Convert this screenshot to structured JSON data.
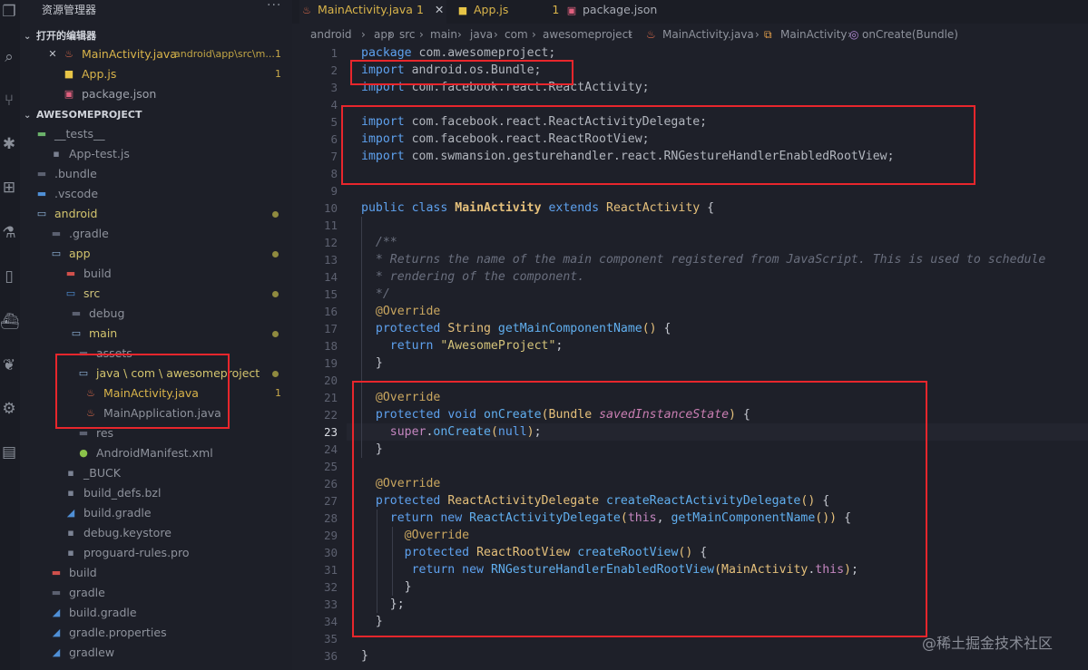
{
  "sidebar": {
    "title": "资源管理器",
    "more": "···",
    "open_editors_header": "打开的编辑器",
    "open_editors": [
      {
        "name": "MainActivity.java",
        "path": "android\\app\\src\\m...",
        "badge": "1",
        "icon": "java-icon"
      },
      {
        "name": "App.js",
        "badge": "1",
        "icon": "js-icon"
      },
      {
        "name": "package.json",
        "icon": "json-icon"
      }
    ],
    "project_header": "AWESOMEPROJECT",
    "tree": [
      {
        "name": "__tests__",
        "kind": "folder-test",
        "depth": 0
      },
      {
        "name": "App-test.js",
        "kind": "test-file",
        "depth": 1
      },
      {
        "name": ".bundle",
        "kind": "folder",
        "depth": 0
      },
      {
        "name": ".vscode",
        "kind": "folder-vscode",
        "depth": 0
      },
      {
        "name": "android",
        "kind": "folder-open",
        "depth": 0,
        "dot": true
      },
      {
        "name": ".gradle",
        "kind": "folder",
        "depth": 1
      },
      {
        "name": "app",
        "kind": "folder-open",
        "depth": 1,
        "dot": true
      },
      {
        "name": "build",
        "kind": "folder-build",
        "depth": 2
      },
      {
        "name": "src",
        "kind": "folder-src",
        "depth": 2,
        "dot": true
      },
      {
        "name": "debug",
        "kind": "folder",
        "depth": 3
      },
      {
        "name": "main",
        "kind": "folder-open",
        "depth": 3,
        "dot": true
      },
      {
        "name": "assets",
        "kind": "folder",
        "depth": 4
      },
      {
        "name": "java \\ com \\ awesomeproject",
        "kind": "folder-open",
        "depth": 4,
        "dot": true
      },
      {
        "name": "MainActivity.java",
        "kind": "java",
        "depth": 5,
        "badge": "1"
      },
      {
        "name": "MainApplication.java",
        "kind": "java",
        "depth": 5
      },
      {
        "name": "res",
        "kind": "folder",
        "depth": 4
      },
      {
        "name": "AndroidManifest.xml",
        "kind": "xml",
        "depth": 4
      },
      {
        "name": "_BUCK",
        "kind": "file",
        "depth": 2
      },
      {
        "name": "build_defs.bzl",
        "kind": "file",
        "depth": 2
      },
      {
        "name": "build.gradle",
        "kind": "gradle",
        "depth": 2
      },
      {
        "name": "debug.keystore",
        "kind": "file",
        "depth": 2
      },
      {
        "name": "proguard-rules.pro",
        "kind": "file",
        "depth": 2
      },
      {
        "name": "build",
        "kind": "folder-build",
        "depth": 1
      },
      {
        "name": "gradle",
        "kind": "folder",
        "depth": 1
      },
      {
        "name": "build.gradle",
        "kind": "gradle",
        "depth": 1
      },
      {
        "name": "gradle.properties",
        "kind": "gradle",
        "depth": 1
      },
      {
        "name": "gradlew",
        "kind": "gradle",
        "depth": 1
      }
    ]
  },
  "tabs": [
    {
      "label": "MainActivity.java",
      "badge": "1",
      "icon": "java-icon",
      "active": true
    },
    {
      "label": "App.js",
      "badge": "1",
      "icon": "js-icon",
      "active": false
    },
    {
      "label": "package.json",
      "icon": "json-icon",
      "active": false
    }
  ],
  "breadcrumb": [
    "android",
    "app",
    "src",
    "main",
    "java",
    "com",
    "awesomeproject",
    "MainActivity.java",
    "MainActivity",
    "onCreate(Bundle)"
  ],
  "editor": {
    "current_line": 23,
    "lines": [
      {
        "n": "1",
        "t": [
          [
            "kw2",
            "package"
          ],
          [
            "pk",
            " com.awesomeproject;"
          ]
        ]
      },
      {
        "n": "2",
        "t": [
          [
            "kw2",
            "import"
          ],
          [
            "pk",
            " android.os.Bundle;"
          ]
        ]
      },
      {
        "n": "3",
        "t": [
          [
            "kw2",
            "import"
          ],
          [
            "pk",
            " com.facebook.react.ReactActivity;"
          ]
        ]
      },
      {
        "n": "4",
        "t": []
      },
      {
        "n": "5",
        "t": [
          [
            "kw2",
            "import"
          ],
          [
            "pk",
            " com.facebook.react.ReactActivityDelegate;"
          ]
        ]
      },
      {
        "n": "6",
        "t": [
          [
            "kw2",
            "import"
          ],
          [
            "pk",
            " com.facebook.react.ReactRootView;"
          ]
        ]
      },
      {
        "n": "7",
        "t": [
          [
            "kw2",
            "import"
          ],
          [
            "pk",
            " com.swmansion.gesturehandler.react.RNGestureHandlerEnabledRootView;"
          ]
        ]
      },
      {
        "n": "8",
        "t": []
      },
      {
        "n": "9",
        "t": []
      },
      {
        "n": "10",
        "t": [
          [
            "kw2",
            "public"
          ],
          [
            "id",
            " "
          ],
          [
            "kw2",
            "class"
          ],
          [
            "id",
            " "
          ],
          [
            "cls",
            "MainActivity"
          ],
          [
            "id",
            " "
          ],
          [
            "kw2",
            "extends"
          ],
          [
            "id",
            " "
          ],
          [
            "ty",
            "ReactActivity"
          ],
          [
            "id",
            " {"
          ]
        ]
      },
      {
        "n": "11",
        "t": []
      },
      {
        "n": "12",
        "t": [
          [
            "id",
            "  "
          ],
          [
            "cm",
            "/**"
          ]
        ]
      },
      {
        "n": "13",
        "t": [
          [
            "id",
            "  "
          ],
          [
            "cm",
            "* Returns the name of the main component registered from JavaScript. This is used to schedule"
          ]
        ]
      },
      {
        "n": "14",
        "t": [
          [
            "id",
            "  "
          ],
          [
            "cm",
            "* rendering of the component."
          ]
        ]
      },
      {
        "n": "15",
        "t": [
          [
            "id",
            "  "
          ],
          [
            "cm",
            "*/"
          ]
        ]
      },
      {
        "n": "16",
        "t": [
          [
            "id",
            "  "
          ],
          [
            "an",
            "@Override"
          ]
        ]
      },
      {
        "n": "17",
        "t": [
          [
            "id",
            "  "
          ],
          [
            "kw2",
            "protected"
          ],
          [
            "id",
            " "
          ],
          [
            "ty",
            "String"
          ],
          [
            "id",
            " "
          ],
          [
            "fn",
            "getMainComponentName"
          ],
          [
            "ty",
            "()"
          ],
          [
            "id",
            " {"
          ]
        ]
      },
      {
        "n": "18",
        "t": [
          [
            "id",
            "    "
          ],
          [
            "kw2",
            "return"
          ],
          [
            "id",
            " "
          ],
          [
            "str",
            "\"AwesomeProject\""
          ],
          [
            "id",
            ";"
          ]
        ]
      },
      {
        "n": "19",
        "t": [
          [
            "id",
            "  }"
          ]
        ]
      },
      {
        "n": "20",
        "t": []
      },
      {
        "n": "21",
        "t": [
          [
            "id",
            "  "
          ],
          [
            "an",
            "@Override"
          ]
        ]
      },
      {
        "n": "22",
        "t": [
          [
            "id",
            "  "
          ],
          [
            "kw2",
            "protected"
          ],
          [
            "id",
            " "
          ],
          [
            "kw2",
            "void"
          ],
          [
            "id",
            " "
          ],
          [
            "fn",
            "onCreate"
          ],
          [
            "ty",
            "("
          ],
          [
            "ty",
            "Bundle"
          ],
          [
            "id",
            " "
          ],
          [
            "param",
            "savedInstanceState"
          ],
          [
            "ty",
            ")"
          ],
          [
            "id",
            " {"
          ]
        ]
      },
      {
        "n": "23",
        "t": [
          [
            "id",
            "    "
          ],
          [
            "kw",
            "super"
          ],
          [
            "id",
            "."
          ],
          [
            "fn",
            "onCreate"
          ],
          [
            "ty",
            "("
          ],
          [
            "kw2",
            "null"
          ],
          [
            "ty",
            ")"
          ],
          [
            "id",
            ";"
          ]
        ]
      },
      {
        "n": "24",
        "t": [
          [
            "id",
            "  }"
          ]
        ]
      },
      {
        "n": "25",
        "t": []
      },
      {
        "n": "26",
        "t": [
          [
            "id",
            "  "
          ],
          [
            "an",
            "@Override"
          ]
        ]
      },
      {
        "n": "27",
        "t": [
          [
            "id",
            "  "
          ],
          [
            "kw2",
            "protected"
          ],
          [
            "id",
            " "
          ],
          [
            "ty",
            "ReactActivityDelegate"
          ],
          [
            "id",
            " "
          ],
          [
            "fn",
            "createReactActivityDelegate"
          ],
          [
            "ty",
            "()"
          ],
          [
            "id",
            " {"
          ]
        ]
      },
      {
        "n": "28",
        "t": [
          [
            "id",
            "    "
          ],
          [
            "kw2",
            "return"
          ],
          [
            "id",
            " "
          ],
          [
            "kw2",
            "new"
          ],
          [
            "id",
            " "
          ],
          [
            "fn",
            "ReactActivityDelegate"
          ],
          [
            "ty",
            "("
          ],
          [
            "kw",
            "this"
          ],
          [
            "id",
            ", "
          ],
          [
            "fn",
            "getMainComponentName"
          ],
          [
            "ty",
            "()"
          ],
          [
            "ty",
            ")"
          ],
          [
            "id",
            " {"
          ]
        ]
      },
      {
        "n": "29",
        "t": [
          [
            "id",
            "      "
          ],
          [
            "an",
            "@Override"
          ]
        ]
      },
      {
        "n": "30",
        "t": [
          [
            "id",
            "      "
          ],
          [
            "kw2",
            "protected"
          ],
          [
            "id",
            " "
          ],
          [
            "ty",
            "ReactRootView"
          ],
          [
            "id",
            " "
          ],
          [
            "fn",
            "createRootView"
          ],
          [
            "ty",
            "()"
          ],
          [
            "id",
            " {"
          ]
        ]
      },
      {
        "n": "31",
        "t": [
          [
            "id",
            "       "
          ],
          [
            "kw2",
            "return"
          ],
          [
            "id",
            " "
          ],
          [
            "kw2",
            "new"
          ],
          [
            "id",
            " "
          ],
          [
            "fn",
            "RNGestureHandlerEnabledRootView"
          ],
          [
            "ty",
            "("
          ],
          [
            "ty",
            "MainActivity"
          ],
          [
            "id",
            "."
          ],
          [
            "kw",
            "this"
          ],
          [
            "ty",
            ")"
          ],
          [
            "id",
            ";"
          ]
        ]
      },
      {
        "n": "32",
        "t": [
          [
            "id",
            "      }"
          ]
        ]
      },
      {
        "n": "33",
        "t": [
          [
            "id",
            "    };"
          ]
        ]
      },
      {
        "n": "34",
        "t": [
          [
            "id",
            "  }"
          ]
        ]
      },
      {
        "n": "35",
        "t": []
      },
      {
        "n": "36",
        "t": [
          [
            "id",
            "}"
          ]
        ]
      }
    ]
  },
  "watermark": "@稀土掘金技术社区",
  "colors": {
    "accent_red": "#e8262c",
    "modified": "#c8a94a"
  }
}
